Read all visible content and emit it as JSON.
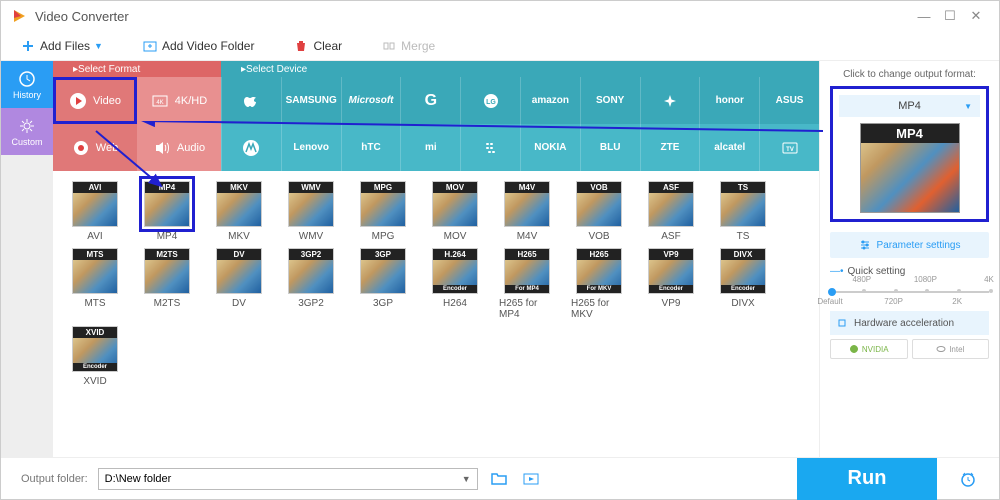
{
  "title": "Video Converter",
  "toolbar": {
    "add_files": "Add Files",
    "add_folder": "Add Video Folder",
    "clear": "Clear",
    "merge": "Merge"
  },
  "sidebar": {
    "history": "History",
    "custom": "Custom"
  },
  "format_head": {
    "select_format": "Select Format",
    "select_device": "Select Device"
  },
  "categories": {
    "video": "Video",
    "fourk": "4K/HD",
    "web": "Web",
    "audio": "Audio"
  },
  "devices_row1": [
    "",
    "SAMSUNG",
    "Microsoft",
    "G",
    "LG",
    "amazon",
    "SONY",
    "",
    "honor",
    "ASUS"
  ],
  "devices_row2": [
    "",
    "Lenovo",
    "hTC",
    "mi",
    "",
    "NOKIA",
    "BLU",
    "ZTE",
    "alcatel",
    ""
  ],
  "formats": [
    [
      "AVI",
      "MP4",
      "MKV",
      "WMV",
      "MPG",
      "MOV",
      "M4V",
      "VOB",
      "ASF",
      "TS"
    ],
    [
      "MTS",
      "M2TS",
      "DV",
      "3GP2",
      "3GP",
      "H264",
      "H265 for MP4",
      "H265 for MKV",
      "VP9",
      "DIVX"
    ],
    [
      "XVID"
    ]
  ],
  "format_badges": {
    "H264": "H.264",
    "H265 for MP4": "H265",
    "H265 for MKV": "H265",
    "VP9": "VP9",
    "DIVX": "DIVX",
    "XVID": "XVID"
  },
  "format_sub": {
    "H264": "Encoder",
    "H265 for MP4": "For MP4",
    "H265 for MKV": "For MKV",
    "VP9": "Encoder",
    "DIVX": "Encoder",
    "XVID": "Encoder"
  },
  "right": {
    "title": "Click to change output format:",
    "selected": "MP4",
    "param_settings": "Parameter settings",
    "quick_setting": "Quick setting",
    "slider_labels_top": [
      "480P",
      "1080P",
      "4K"
    ],
    "slider_labels_bot": [
      "Default",
      "720P",
      "2K"
    ],
    "hw_accel": "Hardware acceleration",
    "nvidia": "NVIDIA",
    "intel": "Intel"
  },
  "bottom": {
    "output_folder_label": "Output folder:",
    "output_folder_value": "D:\\New folder",
    "run": "Run"
  }
}
